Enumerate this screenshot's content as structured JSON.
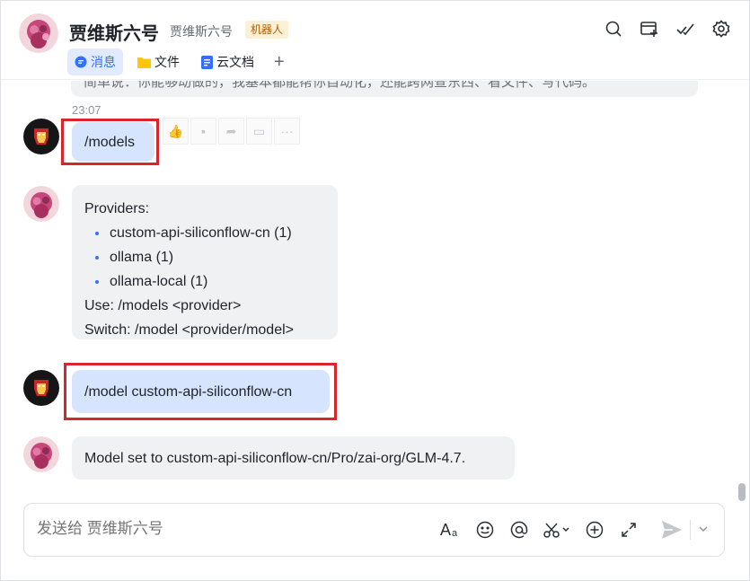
{
  "header": {
    "title": "贾维斯六号",
    "subtitle": "贾维斯六号",
    "badge": "机器人",
    "tabs": [
      {
        "label": "消息",
        "icon": "chat-bubble-icon",
        "active": true
      },
      {
        "label": "文件",
        "icon": "folder-icon",
        "active": false
      },
      {
        "label": "云文档",
        "icon": "doc-icon",
        "active": false
      }
    ],
    "icons": [
      "search-icon",
      "add-window-icon",
      "check-mark-icon",
      "settings-icon"
    ]
  },
  "messages": {
    "cut_text": "简单说：你能够动做的，我基本都能帮你自动化，还能跨网查东西、看文件、写代码。",
    "timestamp": "23:07",
    "user_cmd_1": "/models",
    "providers": {
      "heading": "Providers:",
      "items": [
        "custom-api-siliconflow-cn (1)",
        "ollama (1)",
        "ollama-local (1)"
      ],
      "use_line": "Use: /models <provider>",
      "switch_line": "Switch: /model <provider/model>"
    },
    "user_cmd_2": "/model custom-api-siliconflow-cn",
    "bot_reply": "Model set to custom-api-siliconflow-cn/Pro/zai-org/GLM-4.7."
  },
  "composer": {
    "placeholder": "发送给 贾维斯六号"
  },
  "colors": {
    "accent": "#3370ff",
    "highlight_box": "#d9262c",
    "user_bubble": "#d6e4fd",
    "bot_bubble": "#f0f1f3"
  }
}
